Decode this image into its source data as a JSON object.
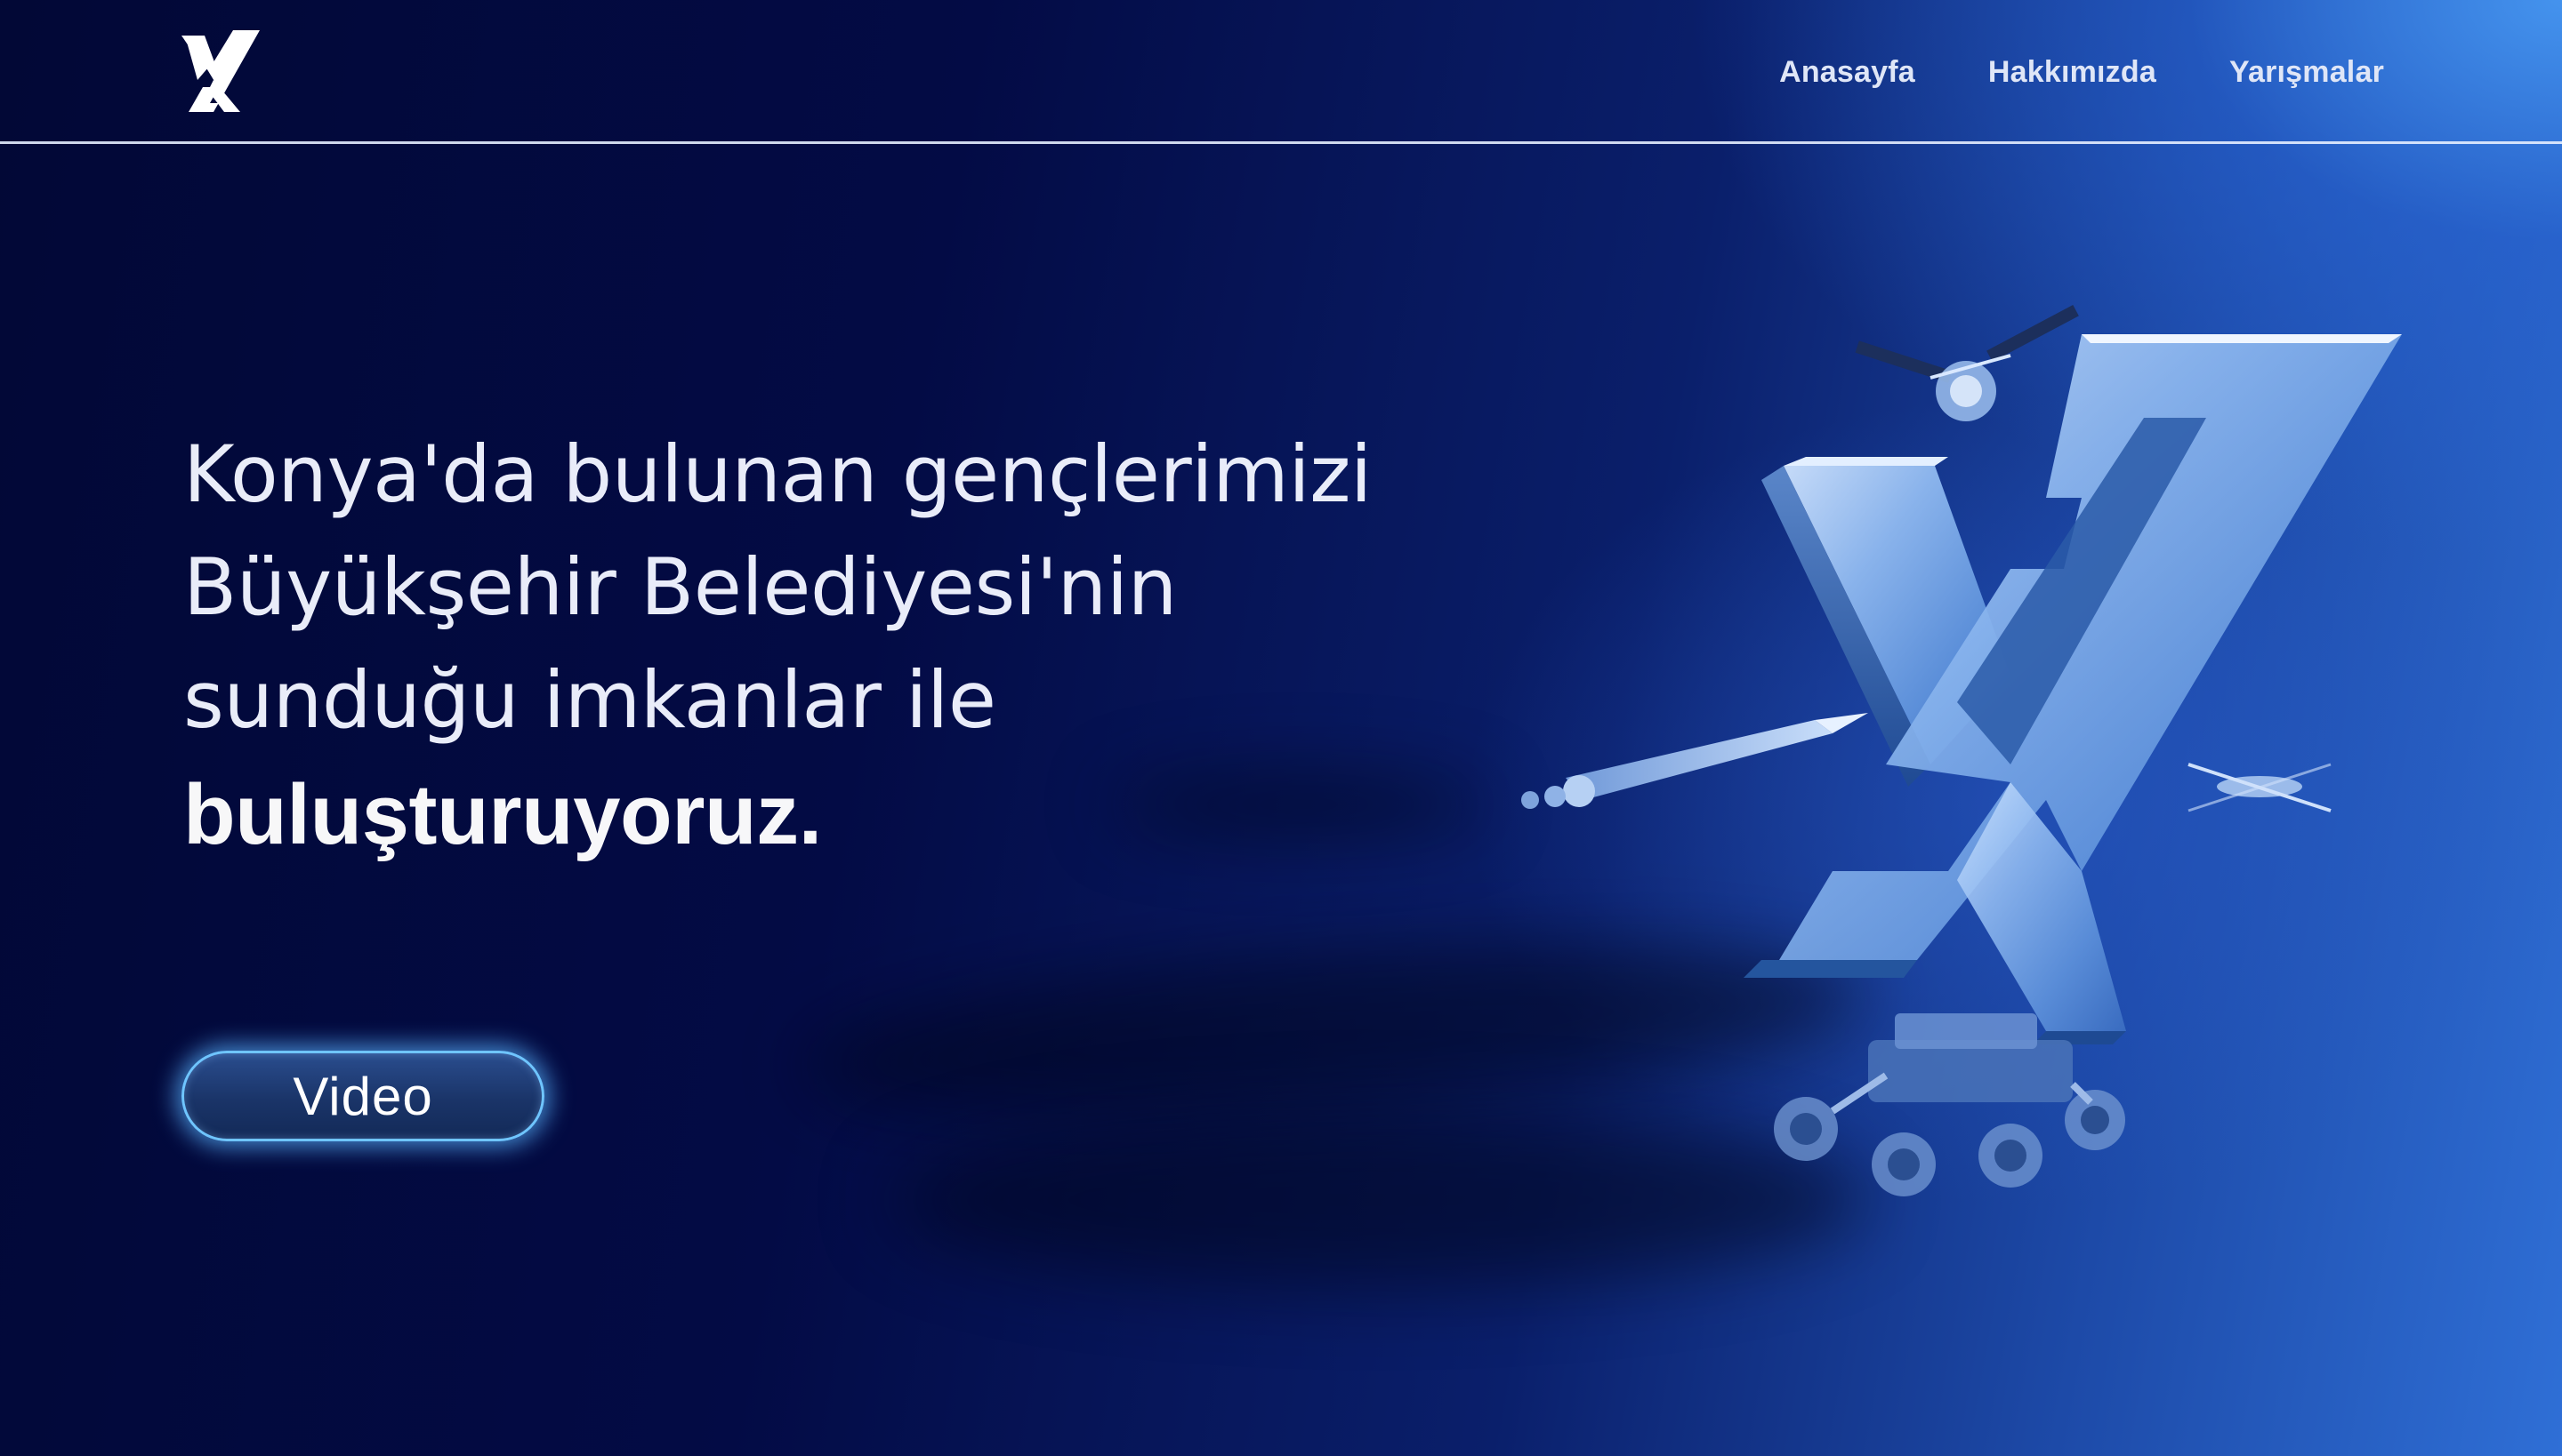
{
  "header": {
    "logo_icon": "x-logo-icon",
    "nav": [
      {
        "label": "Anasayfa"
      },
      {
        "label": "Hakkımızda"
      },
      {
        "label": "Yarışmalar"
      }
    ]
  },
  "hero": {
    "lines": [
      "Konya'da bulunan gençlerimizi",
      "Büyükşehir Belediyesi'nin",
      "sunduğu imkanlar ile"
    ],
    "bold_line": "buluşturuyoruz."
  },
  "cta": {
    "video_label": "Video"
  },
  "colors": {
    "background_dark": "#020836",
    "background_light": "#2f6fd6",
    "button_glow": "#6fc5ff",
    "text": "#ffffff"
  },
  "artwork": {
    "icon": "glass-x-emblem-icon",
    "elements": [
      "satellite-icon",
      "rocket-icon",
      "drone-icon",
      "rover-icon"
    ]
  }
}
